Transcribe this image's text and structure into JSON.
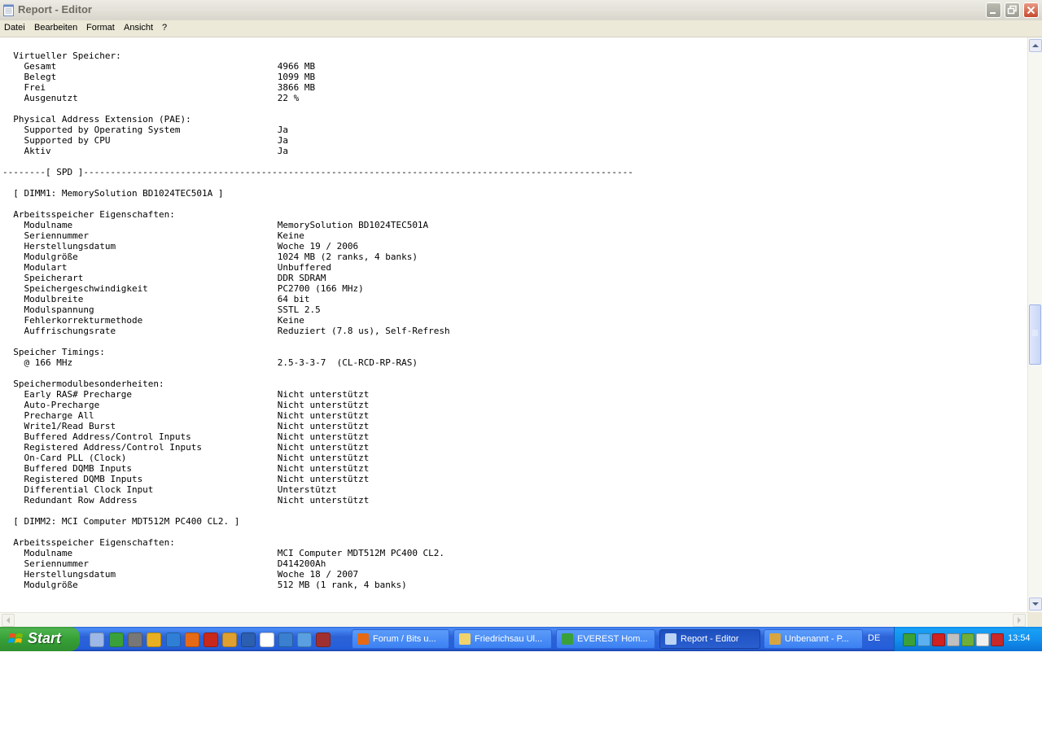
{
  "window": {
    "title": "Report - Editor",
    "menu": [
      "Datei",
      "Bearbeiten",
      "Format",
      "Ansicht",
      "?"
    ]
  },
  "document": {
    "lines": [
      "  Virtueller Speicher:",
      "    Gesamt                                         4966 MB",
      "    Belegt                                         1099 MB",
      "    Frei                                           3866 MB",
      "    Ausgenutzt                                     22 %",
      "",
      "  Physical Address Extension (PAE):",
      "    Supported by Operating System                  Ja",
      "    Supported by CPU                               Ja",
      "    Aktiv                                          Ja",
      "",
      "--------[ SPD ]------------------------------------------------------------------------------------------------------",
      "",
      "  [ DIMM1: MemorySolution BD1024TEC501A ]",
      "",
      "  Arbeitsspeicher Eigenschaften:",
      "    Modulname                                      MemorySolution BD1024TEC501A",
      "    Seriennummer                                   Keine",
      "    Herstellungsdatum                              Woche 19 / 2006",
      "    Modulgröße                                     1024 MB (2 ranks, 4 banks)",
      "    Modulart                                       Unbuffered",
      "    Speicherart                                    DDR SDRAM",
      "    Speichergeschwindigkeit                        PC2700 (166 MHz)",
      "    Modulbreite                                    64 bit",
      "    Modulspannung                                  SSTL 2.5",
      "    Fehlerkorrekturmethode                         Keine",
      "    Auffrischungsrate                              Reduziert (7.8 us), Self-Refresh",
      "",
      "  Speicher Timings:",
      "    @ 166 MHz                                      2.5-3-3-7  (CL-RCD-RP-RAS)",
      "",
      "  Speichermodulbesonderheiten:",
      "    Early RAS# Precharge                           Nicht unterstützt",
      "    Auto-Precharge                                 Nicht unterstützt",
      "    Precharge All                                  Nicht unterstützt",
      "    Write1/Read Burst                              Nicht unterstützt",
      "    Buffered Address/Control Inputs                Nicht unterstützt",
      "    Registered Address/Control Inputs              Nicht unterstützt",
      "    On-Card PLL (Clock)                            Nicht unterstützt",
      "    Buffered DQMB Inputs                           Nicht unterstützt",
      "    Registered DQMB Inputs                         Nicht unterstützt",
      "    Differential Clock Input                       Unterstützt",
      "    Redundant Row Address                          Nicht unterstützt",
      "",
      "  [ DIMM2: MCI Computer MDT512M PC400 CL2. ]",
      "",
      "  Arbeitsspeicher Eigenschaften:",
      "    Modulname                                      MCI Computer MDT512M PC400 CL2.",
      "    Seriennummer                                   D414200Ah",
      "    Herstellungsdatum                              Woche 18 / 2007",
      "    Modulgröße                                     512 MB (1 rank, 4 banks)"
    ]
  },
  "taskbar": {
    "start_label": "Start",
    "quicklaunch": [
      "desktop-icon",
      "info-icon",
      "game-icon",
      "chrome-icon",
      "ie-icon",
      "firefox-icon",
      "opera-icon",
      "firefox-alt-icon",
      "media-player-icon",
      "console-icon",
      "network-icon",
      "messenger-icon",
      "tool-icon"
    ],
    "tasks": [
      {
        "label": "Forum / Bits u...",
        "icon": "firefox-icon",
        "color": "#e66a16"
      },
      {
        "label": "Friedrichsau Ul...",
        "icon": "folder-icon",
        "color": "#f1d36b"
      },
      {
        "label": "EVEREST Hom...",
        "icon": "everest-icon",
        "color": "#3aa13a"
      },
      {
        "label": "Report - Editor",
        "icon": "notepad-icon",
        "color": "#bcd3f4",
        "active": true
      },
      {
        "label": "Unbenannt - P...",
        "icon": "paint-icon",
        "color": "#d9a541"
      }
    ],
    "language": "DE",
    "tray_icons": [
      "everest-tray-icon",
      "network-tray-icon",
      "antivirus-tray-icon",
      "speaker-tray-icon",
      "program-tray-icon",
      "safely-remove-icon",
      "security-shield-icon"
    ],
    "clock": "13:54"
  },
  "colors": {
    "taskbar_blue": "#245edb",
    "start_green": "#37a037",
    "tray_blue": "#1291ee"
  }
}
